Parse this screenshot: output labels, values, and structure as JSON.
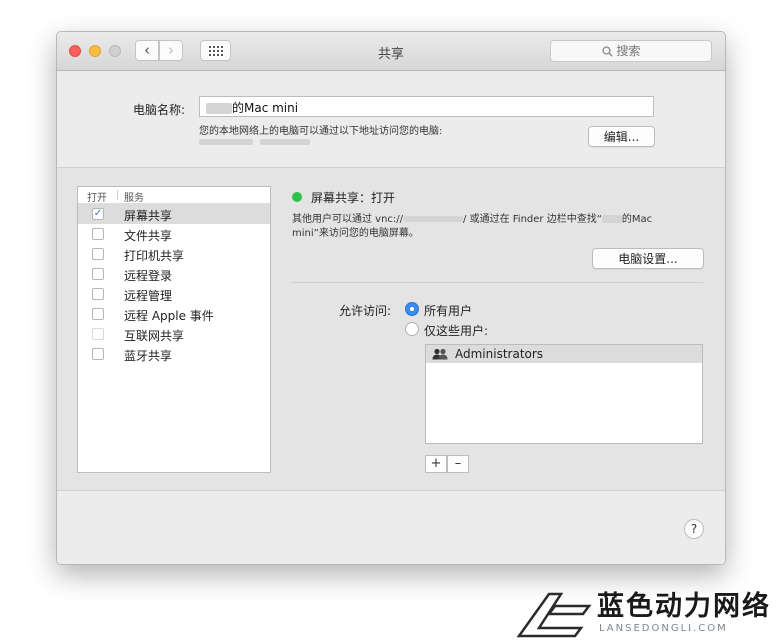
{
  "window": {
    "title": "共享",
    "search_placeholder": "搜索"
  },
  "computer_name": {
    "label": "电脑名称:",
    "value": "的Mac mini",
    "hint": "您的本地网络上的电脑可以通过以下地址访问您的电脑:",
    "edit_button": "编辑..."
  },
  "services": {
    "header_on": "打开",
    "header_service": "服务",
    "items": [
      {
        "label": "屏幕共享",
        "checked": true,
        "selected": true
      },
      {
        "label": "文件共享",
        "checked": false
      },
      {
        "label": "打印机共享",
        "checked": false
      },
      {
        "label": "远程登录",
        "checked": false
      },
      {
        "label": "远程管理",
        "checked": false
      },
      {
        "label": "远程 Apple 事件",
        "checked": false
      },
      {
        "label": "互联网共享",
        "checked": false
      },
      {
        "label": "蓝牙共享",
        "checked": false
      }
    ]
  },
  "detail": {
    "status": "屏幕共享：打开",
    "status_color": "#2fc24b",
    "desc_part1": "其他用户可以通过 vnc://",
    "desc_part2": "/ 或通过在 Finder 边栏中查找“",
    "desc_part3": "的Mac",
    "desc_part4": "mini”来访问您的电脑屏幕。",
    "computer_settings_button": "电脑设置...",
    "allow_access_label": "允许访问:",
    "option_all": "所有用户",
    "option_only": "仅这些用户:",
    "selected_option": "all",
    "users": [
      "Administrators"
    ],
    "add": "+",
    "remove": "–"
  },
  "help": "?",
  "watermark": {
    "cn": "蓝色动力网络",
    "en": "LANSEDONGLI.COM"
  },
  "colors": {
    "accent": "#3b8cf0",
    "status_green": "#2fc24b"
  }
}
